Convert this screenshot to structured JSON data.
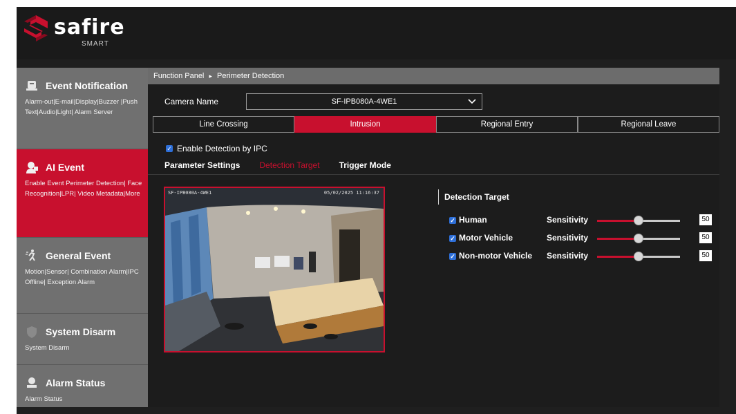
{
  "brand": {
    "name": "safire",
    "sub": "SMART",
    "accent": "#c8102e"
  },
  "sidebar": {
    "items": [
      {
        "title": "Event Notification",
        "icon": "bell-icon",
        "links": "Alarm-out|E-mail|Display|Buzzer |Push Text|Audio|Light| Alarm Server"
      },
      {
        "title": "AI Event",
        "icon": "ai-person-icon",
        "links": "Enable Event Perimeter Detection| Face Recognition|LPR| Video Metadata|More",
        "active": true
      },
      {
        "title": "General Event",
        "icon": "motion-icon",
        "links": "Motion|Sensor| Combination Alarm|IPC Offline| Exception Alarm"
      },
      {
        "title": "System Disarm",
        "icon": "shield-icon",
        "links": "System Disarm"
      },
      {
        "title": "Alarm Status",
        "icon": "alarm-status-icon",
        "links": "Alarm Status"
      }
    ]
  },
  "breadcrumb": {
    "root": "Function Panel",
    "sep": "▸",
    "current": "Perimeter Detection"
  },
  "camera": {
    "label": "Camera Name",
    "value": "SF-IPB080A-4WE1"
  },
  "tabs": [
    "Line Crossing",
    "Intrusion",
    "Regional Entry",
    "Regional Leave"
  ],
  "active_tab": "Intrusion",
  "enable": {
    "label": "Enable Detection by IPC",
    "checked": true
  },
  "subtabs": [
    "Parameter Settings",
    "Detection Target",
    "Trigger Mode"
  ],
  "active_subtab": "Detection Target",
  "video": {
    "osd_left": "SF-IPB080A-4WE1",
    "osd_right": "05/02/2025 11:16:37"
  },
  "detection": {
    "title": "Detection Target",
    "sensitivity_label": "Sensitivity",
    "targets": [
      {
        "name": "Human",
        "checked": true,
        "value": "50"
      },
      {
        "name": "Motor Vehicle",
        "checked": true,
        "value": "50"
      },
      {
        "name": "Non-motor Vehicle",
        "checked": true,
        "value": "50"
      }
    ]
  }
}
